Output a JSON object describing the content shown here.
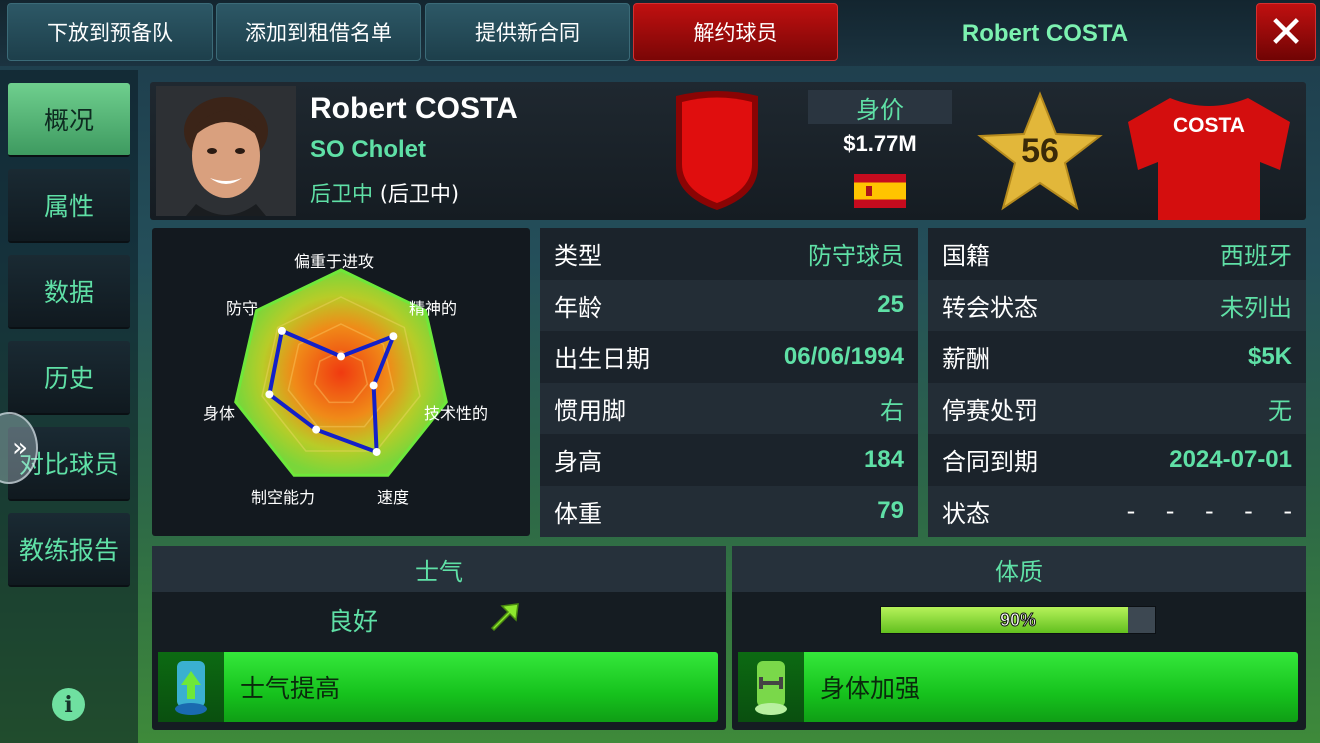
{
  "topbar": {
    "buttons": [
      "下放到预备队",
      "添加到租借名单",
      "提供新合同",
      "解约球员"
    ],
    "title": "Robert COSTA",
    "close": "✕"
  },
  "sidebar": {
    "items": [
      "概况",
      "属性",
      "数据",
      "历史",
      "对比球员",
      "教练报告"
    ],
    "active_index": 0,
    "expand": "»",
    "info": "i"
  },
  "player": {
    "name": "Robert COSTA",
    "club": "SO Cholet",
    "position_primary": "后卫中",
    "position_secondary": "(后卫中)",
    "value_label": "身价",
    "value": "$1.77M",
    "rating": "56",
    "shirt_name": "COSTA",
    "nationality_flag": "spain-flag",
    "badge_color": "#d20a0a",
    "shirt_color": "#d40e0e"
  },
  "radar": {
    "labels": [
      "偏重于进攻",
      "精神的",
      "技术性的",
      "速度",
      "制空能力",
      "身体",
      "防守"
    ],
    "values": [
      0.2,
      0.62,
      0.31,
      0.76,
      0.53,
      0.68,
      0.7
    ]
  },
  "stats_left": [
    {
      "k": "类型",
      "v": "防守球员"
    },
    {
      "k": "年龄",
      "v": "25"
    },
    {
      "k": "出生日期",
      "v": "06/06/1994"
    },
    {
      "k": "惯用脚",
      "v": "右"
    },
    {
      "k": "身高",
      "v": "184"
    },
    {
      "k": "体重",
      "v": "79"
    }
  ],
  "stats_right": [
    {
      "k": "国籍",
      "v": "西班牙"
    },
    {
      "k": "转会状态",
      "v": "未列出"
    },
    {
      "k": "薪酬",
      "v": "$5K"
    },
    {
      "k": "停赛处罚",
      "v": "无"
    },
    {
      "k": "合同到期",
      "v": "2024-07-01"
    },
    {
      "k": "状态",
      "v": "-    -    -    -    -"
    }
  ],
  "morale": {
    "title": "士气",
    "status": "良好",
    "trend_icon": "arrow-up-right-icon",
    "action": "士气提高"
  },
  "fitness": {
    "title": "体质",
    "value_text": "90%",
    "value": 0.9,
    "action": "身体加强"
  }
}
